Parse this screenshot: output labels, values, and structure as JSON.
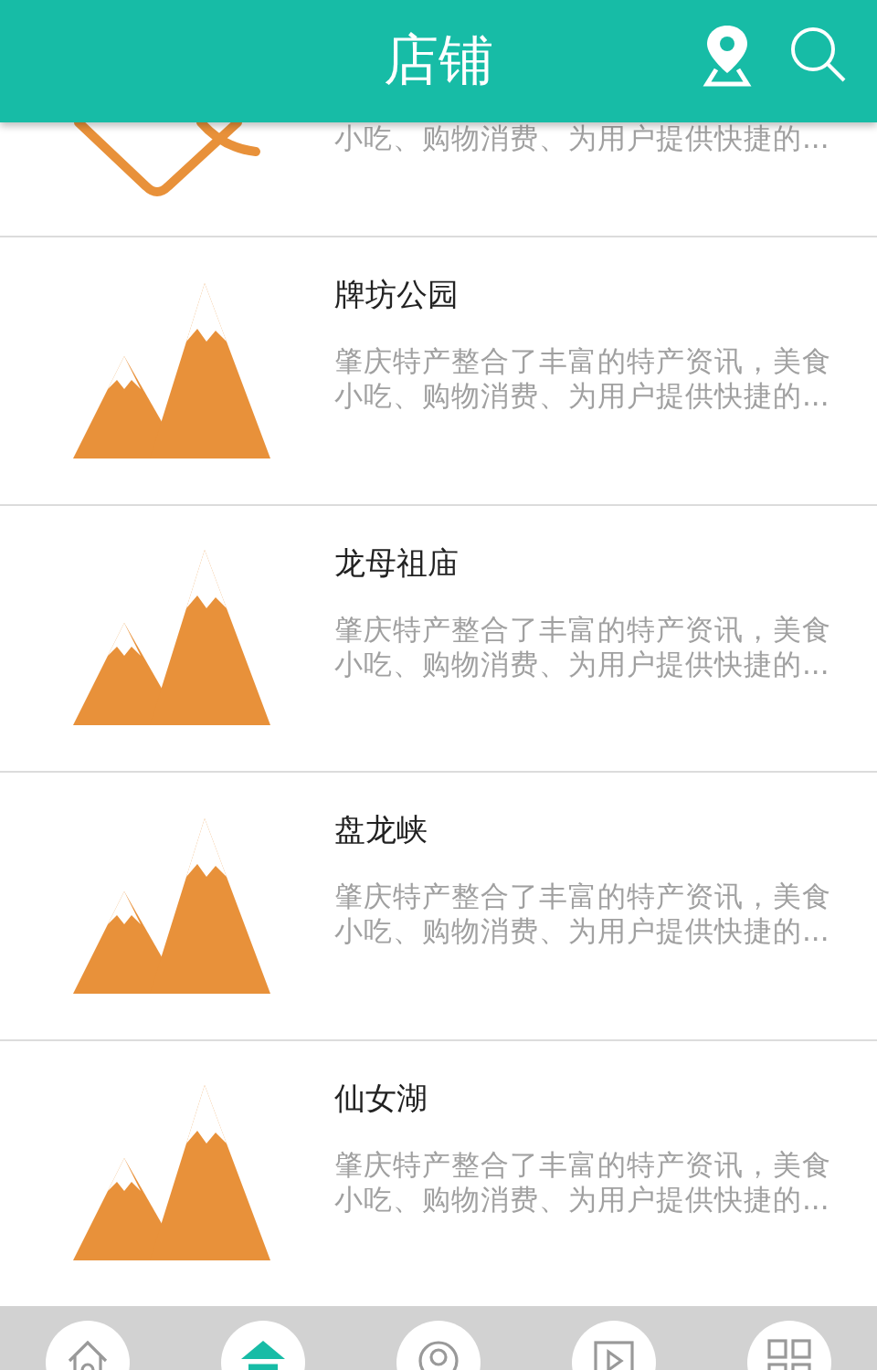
{
  "header": {
    "title": "店铺"
  },
  "items": [
    {
      "kind": "partial",
      "description": "小吃、购物消费、为用户提供快捷的..."
    },
    {
      "kind": "full",
      "title": "牌坊公园",
      "description": "肇庆特产整合了丰富的特产资讯，美食小吃、购物消费、为用户提供快捷的..."
    },
    {
      "kind": "full",
      "title": "龙母祖庙",
      "description": "肇庆特产整合了丰富的特产资讯，美食小吃、购物消费、为用户提供快捷的..."
    },
    {
      "kind": "full",
      "title": "盘龙峡",
      "description": "肇庆特产整合了丰富的特产资讯，美食小吃、购物消费、为用户提供快捷的..."
    },
    {
      "kind": "full",
      "title": "仙女湖",
      "description": "肇庆特产整合了丰富的特产资讯，美食小吃、购物消费、为用户提供快捷的..."
    }
  ],
  "nav": [
    {
      "kind": "home",
      "selected": false
    },
    {
      "kind": "shop",
      "selected": true
    },
    {
      "kind": "target",
      "selected": false
    },
    {
      "kind": "video",
      "selected": false
    },
    {
      "kind": "grid",
      "selected": false
    }
  ]
}
